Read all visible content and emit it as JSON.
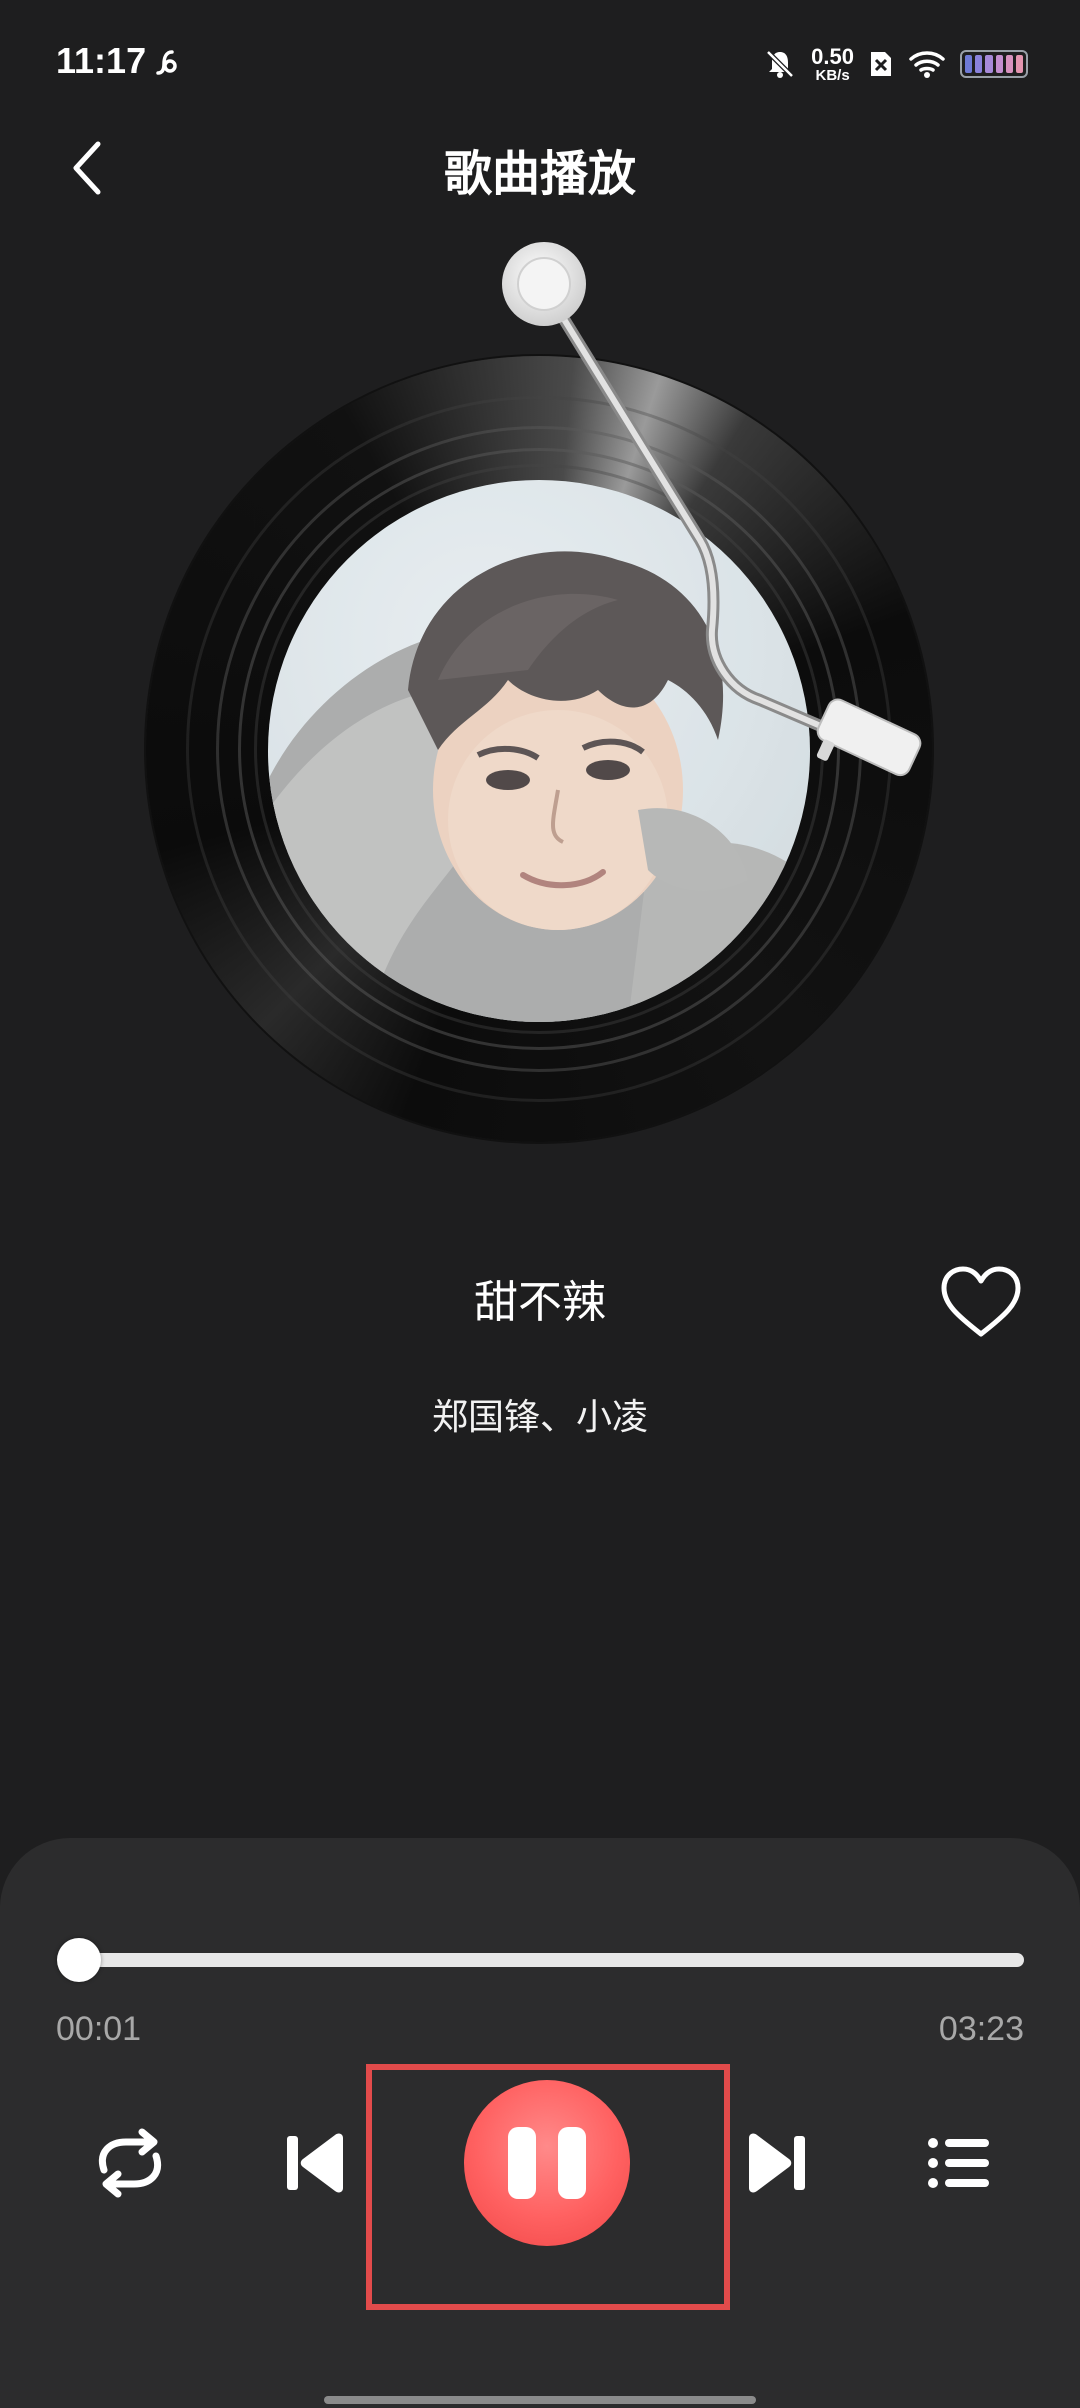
{
  "status_bar": {
    "time": "11:17",
    "net_speed_value": "0.50",
    "net_speed_unit": "KB/s"
  },
  "header": {
    "title": "歌曲播放"
  },
  "song": {
    "title": "甜不辣",
    "artist": "郑国锋、小凌"
  },
  "player": {
    "current_time": "00:01",
    "total_time": "03:23",
    "progress_fraction": 0.005,
    "state": "playing"
  },
  "icons": {
    "back": "chevron-left-icon",
    "like": "heart-outline-icon",
    "repeat": "repeat-icon",
    "previous": "skip-previous-icon",
    "pause": "pause-icon",
    "next": "skip-next-icon",
    "playlist": "playlist-icon"
  },
  "colors": {
    "background": "#1e1e1f",
    "panel": "#2c2c2d",
    "accent": "#ff6161",
    "highlight": "#e24b4b"
  }
}
